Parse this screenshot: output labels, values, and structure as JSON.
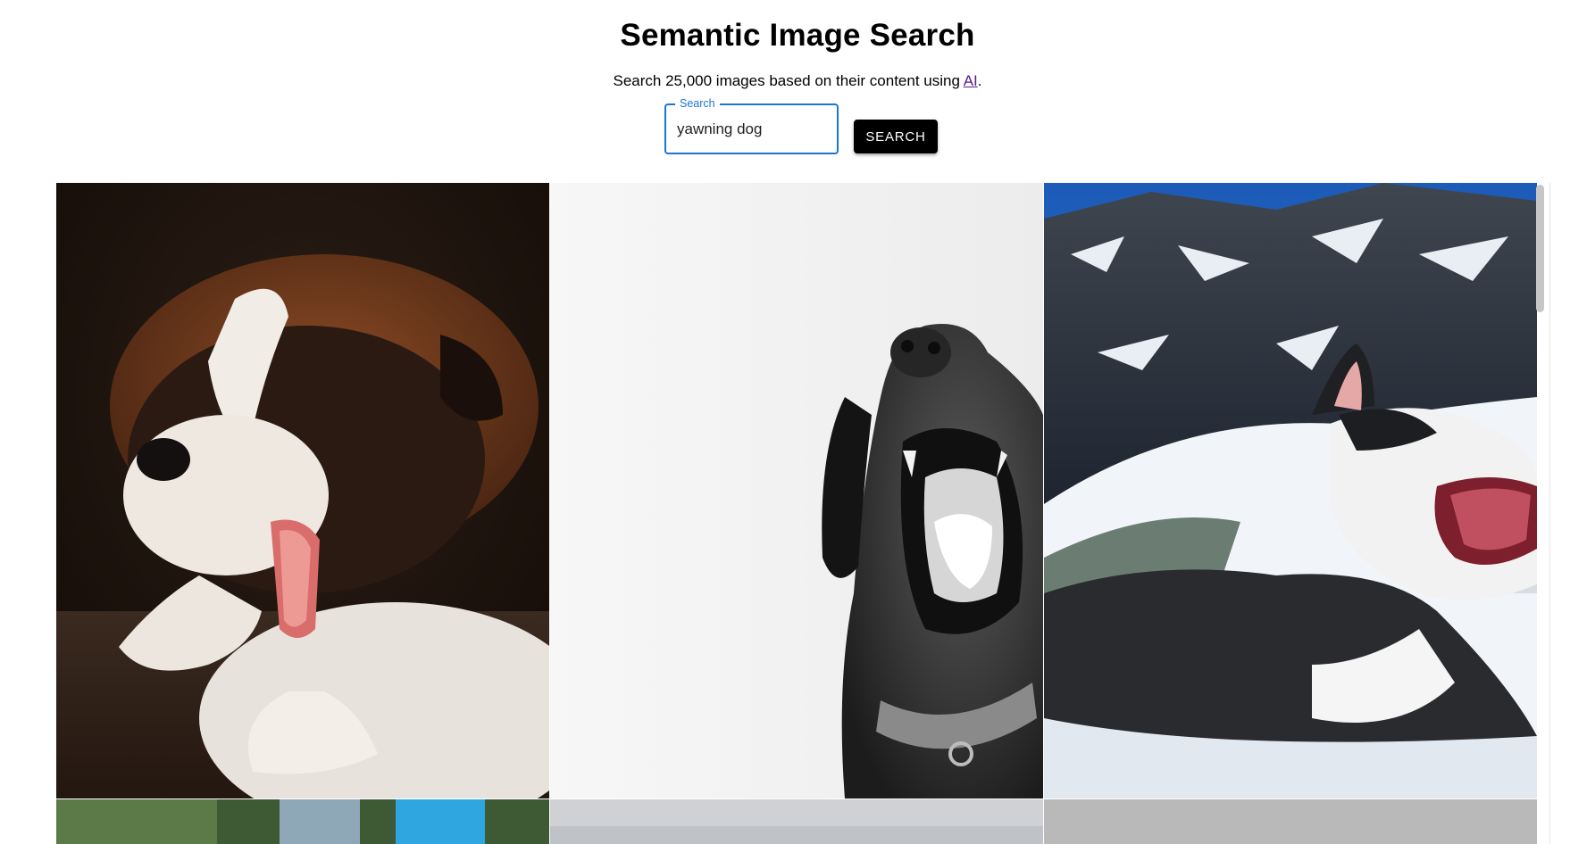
{
  "header": {
    "title": "Semantic Image Search",
    "subtitle_prefix": "Search 25,000 images based on their content using ",
    "subtitle_link": "AI",
    "subtitle_suffix": "."
  },
  "search": {
    "label": "Search",
    "value": "yawning dog",
    "button_label": "SEARCH"
  },
  "colors": {
    "accent": "#1976d2",
    "button_bg": "#000000",
    "link": "#551a8b"
  }
}
